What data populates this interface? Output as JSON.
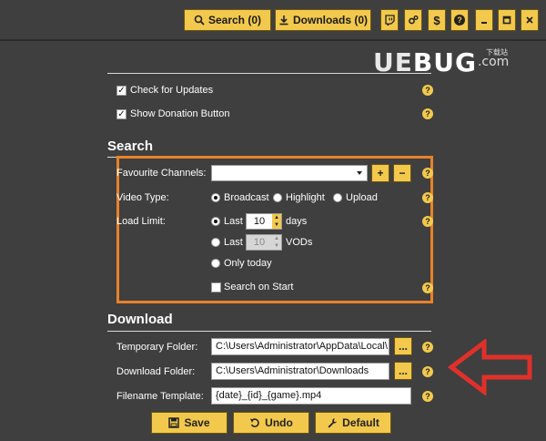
{
  "toolbar": {
    "search_label": "Search (0)",
    "downloads_label": "Downloads (0)"
  },
  "watermark": {
    "text_a": "UE",
    "text_b": "BUG",
    "text_c": ".com",
    "small": "下载站"
  },
  "general": {
    "check_updates_label": "Check for Updates",
    "donation_label": "Show Donation Button"
  },
  "search": {
    "title": "Search",
    "favourite_label": "Favourite Channels:",
    "video_type_label": "Video Type:",
    "video_types": [
      "Broadcast",
      "Highlight",
      "Upload"
    ],
    "load_limit_label": "Load Limit:",
    "last_label": "Last",
    "days_value": "10",
    "days_unit": "days",
    "vods_value": "10",
    "vods_unit": "VODs",
    "only_today_label": "Only today",
    "search_on_start_label": "Search on Start"
  },
  "download": {
    "title": "Download",
    "temp_label": "Temporary Folder:",
    "temp_value": "C:\\Users\\Administrator\\AppData\\Local\\",
    "folder_label": "Download Folder:",
    "folder_value": "C:\\Users\\Administrator\\Downloads",
    "template_label": "Filename Template:",
    "template_value": "{date}_{id}_{game}.mp4",
    "browse_label": "..."
  },
  "footer": {
    "save_label": "Save",
    "undo_label": "Undo",
    "default_label": "Default"
  },
  "colors": {
    "accent": "#f2c94c",
    "highlight_box": "#e8822a",
    "arrow": "#e0302a",
    "background": "#3f3f3f"
  }
}
